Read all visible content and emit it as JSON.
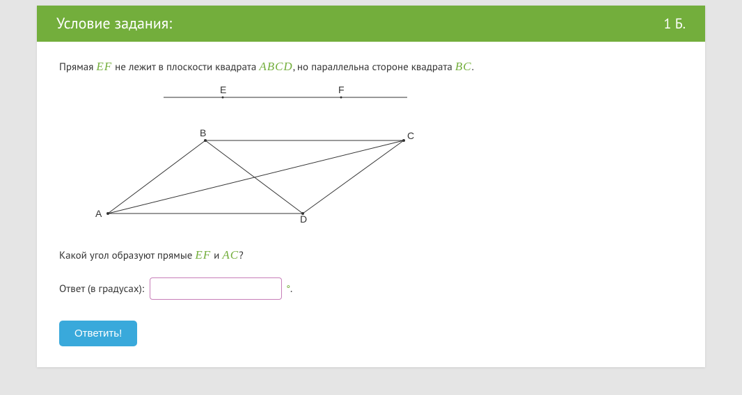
{
  "header": {
    "title": "Условие задания:",
    "points": "1 Б."
  },
  "problem": {
    "text_before_ef": "Прямая ",
    "ef": "EF",
    "text_mid1": " не лежит в плоскости квадрата ",
    "abcd": "ABCD",
    "text_mid2": ", но параллельна стороне квадрата ",
    "bc": "BC",
    "text_end": "."
  },
  "diagram": {
    "points": {
      "A": "A",
      "B": "B",
      "C": "C",
      "D": "D",
      "E": "E",
      "F": "F"
    }
  },
  "question": {
    "text_before": "Какой угол образуют прямые ",
    "ef": "EF",
    "text_mid": " и ",
    "ac": "AC",
    "text_end": "?"
  },
  "answer": {
    "label": "Ответ (в градусах):",
    "value": "",
    "degree": "°",
    "period": "."
  },
  "submit": {
    "label": "Ответить!"
  }
}
